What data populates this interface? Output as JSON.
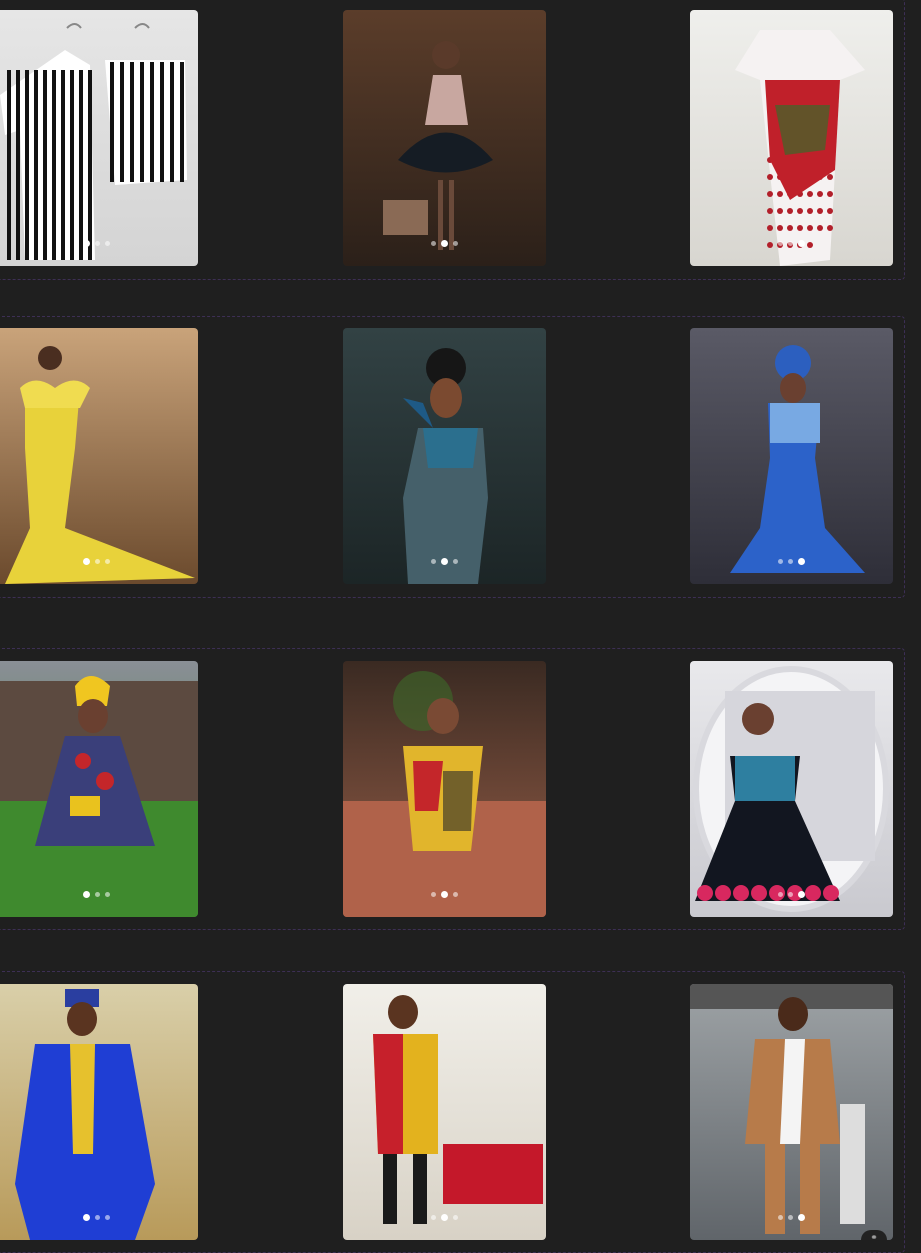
{
  "grid": {
    "rows": [
      {
        "cards": [
          {
            "name": "striped-shirt-shorts-set",
            "bg": [
              "#e6e6e6",
              "#d4d4d4"
            ],
            "dots": 3,
            "active": 0
          },
          {
            "name": "girl-tutu-dress",
            "bg": [
              "#5b3d2a",
              "#2b2019"
            ],
            "dots": 3,
            "active": 1
          },
          {
            "name": "ankara-lace-gown",
            "bg": [
              "#efefec",
              "#d8d6d0"
            ],
            "dots": 3,
            "active": 2
          }
        ]
      },
      {
        "cards": [
          {
            "name": "yellow-sequin-mermaid-gown",
            "bg": [
              "#c9a37a",
              "#6b4a2d"
            ],
            "dots": 3,
            "active": 0
          },
          {
            "name": "blue-asoebi-dress",
            "bg": [
              "#324244",
              "#1c2526"
            ],
            "dots": 3,
            "active": 1
          },
          {
            "name": "royal-blue-mermaid-gown",
            "bg": [
              "#5a5a66",
              "#2e2e38"
            ],
            "dots": 3,
            "active": 2
          }
        ]
      },
      {
        "cards": [
          {
            "name": "toddler-ankara-dress",
            "bg": [
              "#8a8f96",
              "#3b7a2e"
            ],
            "dots": 3,
            "active": 0
          },
          {
            "name": "girl-ankara-flare-dress",
            "bg": [
              "#3a2a22",
              "#9a6049"
            ],
            "dots": 3,
            "active": 1
          },
          {
            "name": "girl-ankara-tulle-gown",
            "bg": [
              "#e9e9ec",
              "#c9c9cf"
            ],
            "dots": 3,
            "active": 2
          }
        ]
      },
      {
        "cards": [
          {
            "name": "blue-agbada-senator",
            "bg": [
              "#d9cfa9",
              "#b89a5a"
            ],
            "dots": 3,
            "active": 0
          },
          {
            "name": "two-tone-senator-outfit",
            "bg": [
              "#f1efe9",
              "#d8d2c6"
            ],
            "dots": 3,
            "active": 1
          },
          {
            "name": "brown-white-kaftan",
            "bg": [
              "#9ea3a6",
              "#60656a"
            ],
            "dots": 3,
            "active": 2
          }
        ]
      }
    ]
  },
  "colors": {
    "page_bg": "#1f1f1f",
    "row_border": "#3d2f55",
    "dot": "#ffffff"
  }
}
